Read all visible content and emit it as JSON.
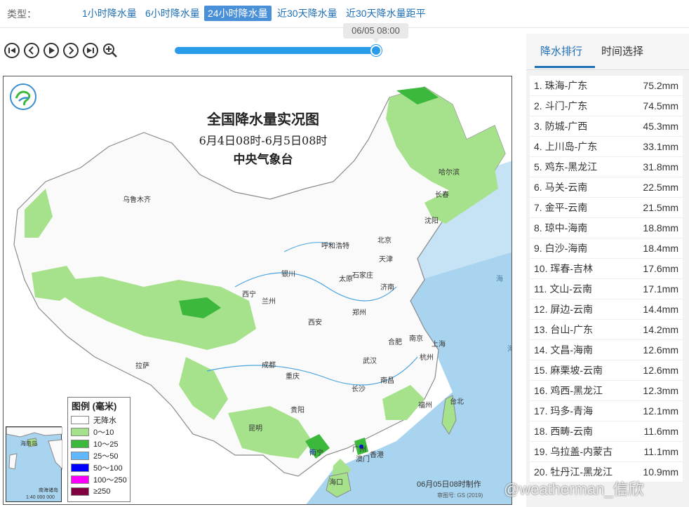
{
  "type_bar": {
    "label": "类型：",
    "options": [
      "1小时降水量",
      "6小时降水量",
      "24小时降水量",
      "近30天降水量",
      "近30天降水量距平"
    ],
    "active_index": 2
  },
  "timeline": {
    "current_time": "06/05 08:00",
    "progress": 1.0
  },
  "map": {
    "title": "全国降水量实况图",
    "period": "6月4日08时-6月5日08时",
    "agency": "中央气象台",
    "footer_time": "06月05日08时制作",
    "footer_code": "审图号: GS (2019)",
    "inset_scale": "1:40 000 000",
    "inset_labels": [
      "海南岛",
      "南海诸岛"
    ],
    "sea_labels": [
      "海",
      "海"
    ],
    "cities": [
      "乌鲁木齐",
      "哈尔滨",
      "长春",
      "沈阳",
      "呼和浩特",
      "北京",
      "天津",
      "石家庄",
      "太原",
      "银川",
      "济南",
      "西宁",
      "兰州",
      "郑州",
      "西安",
      "合肥",
      "南京",
      "上海",
      "杭州",
      "武汉",
      "成都",
      "重庆",
      "长沙",
      "南昌",
      "福州",
      "台北",
      "拉萨",
      "贵阳",
      "昆明",
      "南宁",
      "广州",
      "香港",
      "澳门",
      "海口"
    ],
    "legend": {
      "title": "图例 (毫米)",
      "items": [
        {
          "label": "无降水",
          "color": "#ffffff"
        },
        {
          "label": "0～10",
          "color": "#a6e28c"
        },
        {
          "label": "10～25",
          "color": "#3cb83c"
        },
        {
          "label": "25～50",
          "color": "#62b8ff"
        },
        {
          "label": "50～100",
          "color": "#0000fe"
        },
        {
          "label": "100～250",
          "color": "#fa00fa"
        },
        {
          "label": "≥250",
          "color": "#7f0040"
        }
      ]
    }
  },
  "sidebar": {
    "tabs": [
      "降水排行",
      "时间选择"
    ],
    "active_tab": 0,
    "ranking": [
      {
        "name": "1. 珠海-广东",
        "value": "75.2mm"
      },
      {
        "name": "2. 斗门-广东",
        "value": "74.5mm"
      },
      {
        "name": "3. 防城-广西",
        "value": "45.3mm"
      },
      {
        "name": "4. 上川岛-广东",
        "value": "33.1mm"
      },
      {
        "name": "5. 鸡东-黑龙江",
        "value": "31.8mm"
      },
      {
        "name": "6. 马关-云南",
        "value": "22.5mm"
      },
      {
        "name": "7. 金平-云南",
        "value": "21.5mm"
      },
      {
        "name": "8. 琼中-海南",
        "value": "18.8mm"
      },
      {
        "name": "9. 白沙-海南",
        "value": "18.4mm"
      },
      {
        "name": "10. 珲春-吉林",
        "value": "17.6mm"
      },
      {
        "name": "11. 文山-云南",
        "value": "17.1mm"
      },
      {
        "name": "12. 屏边-云南",
        "value": "14.4mm"
      },
      {
        "name": "13. 台山-广东",
        "value": "14.2mm"
      },
      {
        "name": "14. 文昌-海南",
        "value": "12.6mm"
      },
      {
        "name": "15. 麻栗坡-云南",
        "value": "12.6mm"
      },
      {
        "name": "16. 鸡西-黑龙江",
        "value": "12.3mm"
      },
      {
        "name": "17. 玛多-青海",
        "value": "12.1mm"
      },
      {
        "name": "18. 西畴-云南",
        "value": "11.6mm"
      },
      {
        "name": "19. 乌拉盖-内蒙古",
        "value": "11.1mm"
      },
      {
        "name": "20. 牡丹江-黑龙江",
        "value": "10.9mm"
      }
    ]
  },
  "watermark": "@weatherman_信欣",
  "colors": {
    "accent": "#1f6fb5",
    "active_bg": "#4a90d9",
    "slider": "#2a9be8",
    "sea": "#a8d4f0",
    "light_rain": "#a6e28c",
    "moderate_rain": "#3cb83c"
  }
}
